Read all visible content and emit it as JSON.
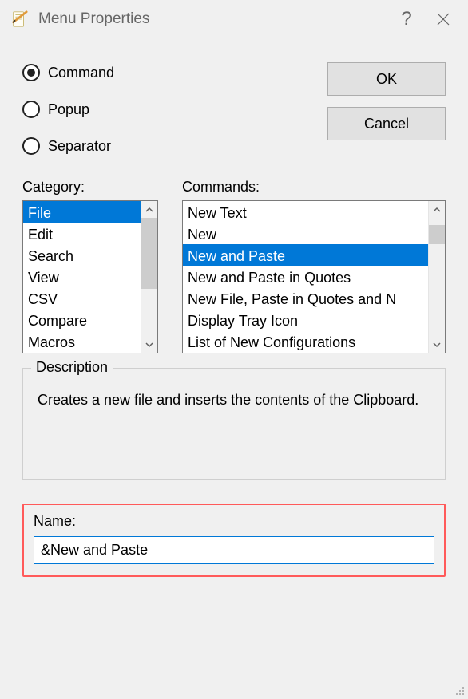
{
  "window": {
    "title": "Menu Properties"
  },
  "radios": {
    "command": "Command",
    "popup": "Popup",
    "separator": "Separator",
    "selected": "command"
  },
  "buttons": {
    "ok": "OK",
    "cancel": "Cancel"
  },
  "lists": {
    "category_label": "Category:",
    "commands_label": "Commands:",
    "categories": [
      "File",
      "Edit",
      "Search",
      "View",
      "CSV",
      "Compare",
      "Macros"
    ],
    "category_selected_index": 0,
    "commands": [
      "New Text",
      "New",
      "New and Paste",
      "New and Paste in Quotes",
      "New File, Paste in Quotes and N",
      "Display Tray Icon",
      "List of New Configurations"
    ],
    "command_selected_index": 2
  },
  "description": {
    "legend": "Description",
    "text": "Creates a new file and inserts the contents of the Clipboard."
  },
  "name": {
    "label": "Name:",
    "value": "&New and Paste"
  }
}
